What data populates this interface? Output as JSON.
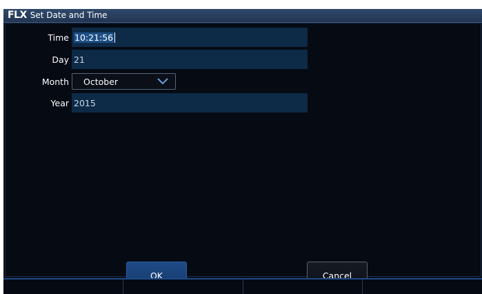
{
  "app": {
    "logo": "FLX",
    "title": "Set Date and Time"
  },
  "form": {
    "time": {
      "label": "Time",
      "value": "10:21:56"
    },
    "day": {
      "label": "Day",
      "value": "21"
    },
    "month": {
      "label": "Month",
      "value": "October"
    },
    "year": {
      "label": "Year",
      "value": "2015"
    }
  },
  "buttons": {
    "ok": "OK",
    "cancel": "Cancel"
  },
  "icons": {
    "month_dropdown": "chevron-down-icon"
  },
  "colors": {
    "accent": "#1e4a86",
    "field_bg": "#0d2a47",
    "background": "#050a13"
  }
}
